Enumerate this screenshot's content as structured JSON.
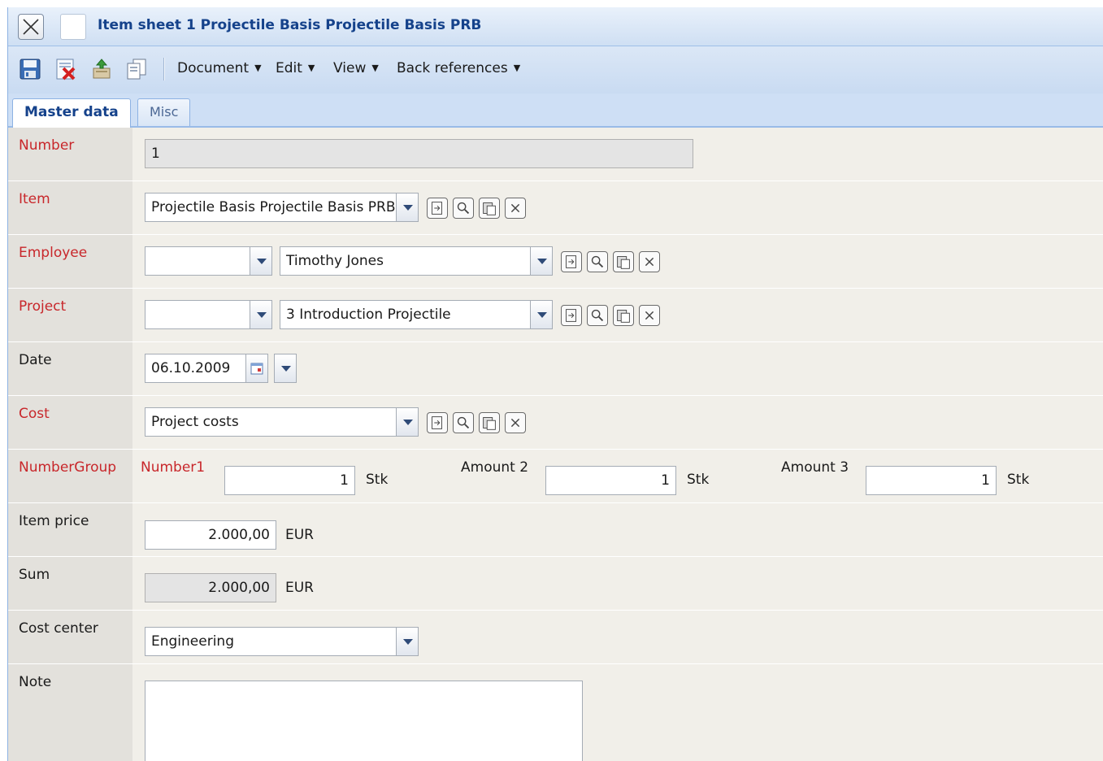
{
  "titlebar": {
    "title": "Item sheet 1 Projectile Basis Projectile Basis PRB"
  },
  "toolbar": {
    "icons": [
      "save-icon",
      "delete-icon",
      "export-icon",
      "copy-icon"
    ],
    "menus": [
      {
        "label": "Document"
      },
      {
        "label": "Edit"
      },
      {
        "label": "View"
      },
      {
        "label": "Back references"
      }
    ]
  },
  "tabs": [
    {
      "label": "Master data",
      "active": true
    },
    {
      "label": "Misc",
      "active": false
    }
  ],
  "form": {
    "number": {
      "label": "Number",
      "value": "1"
    },
    "item": {
      "label": "Item",
      "value": "Projectile Basis Projectile Basis PRB"
    },
    "employee": {
      "label": "Employee",
      "prefix": "",
      "value": "Timothy Jones"
    },
    "project": {
      "label": "Project",
      "prefix": "",
      "value": "3 Introduction Projectile"
    },
    "date": {
      "label": "Date",
      "value": "06.10.2009"
    },
    "cost": {
      "label": "Cost",
      "value": "Project costs"
    },
    "numbergroup": {
      "label": "NumberGroup",
      "number1_label": "Number1",
      "number1_value": "1",
      "number1_unit": "Stk",
      "amount2_label": "Amount 2",
      "amount2_value": "1",
      "amount2_unit": "Stk",
      "amount3_label": "Amount 3",
      "amount3_value": "1",
      "amount3_unit": "Stk"
    },
    "item_price": {
      "label": "Item price",
      "value": "2.000,00",
      "unit": "EUR"
    },
    "sum": {
      "label": "Sum",
      "value": "2.000,00",
      "unit": "EUR"
    },
    "cost_center": {
      "label": "Cost center",
      "value": "Engineering"
    },
    "note": {
      "label": "Note",
      "value": ""
    }
  },
  "colors": {
    "required_label": "#c8272b",
    "title": "#15428b",
    "accent": "#99bbe8"
  }
}
